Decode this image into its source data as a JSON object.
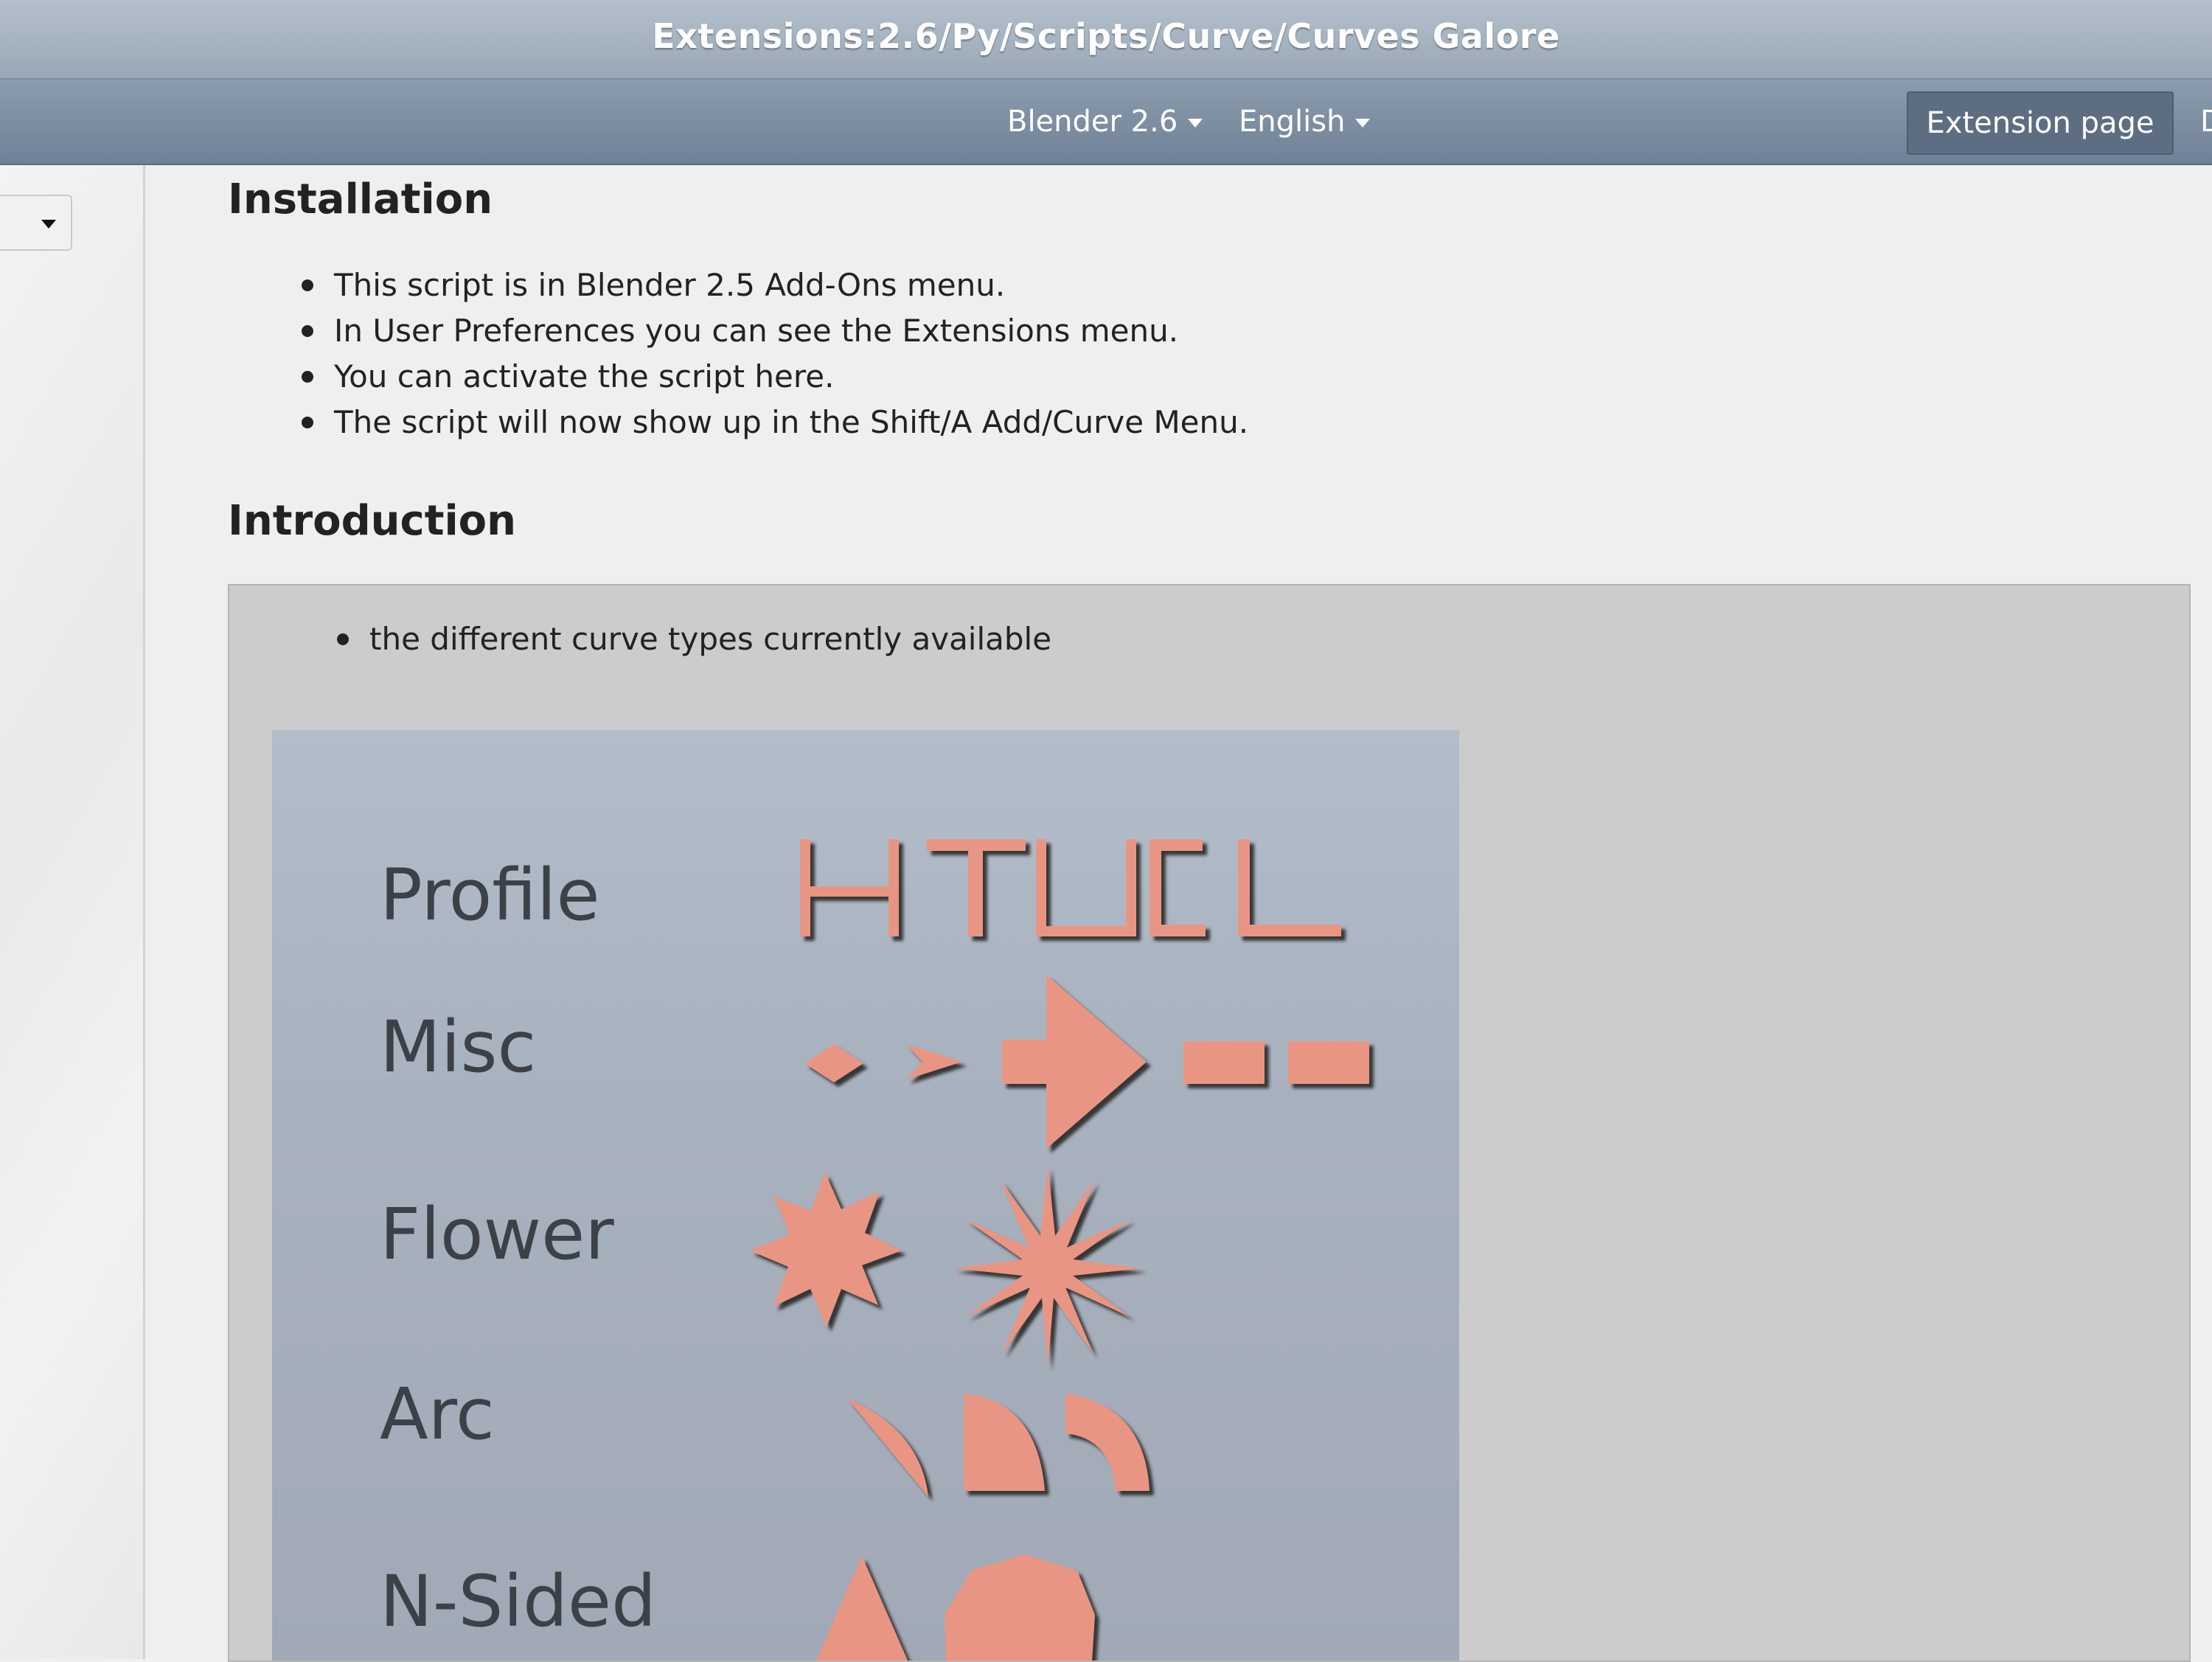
{
  "window": {
    "title": "Extensions:2.6/Py/Scripts/Curve/Curves Galore"
  },
  "nav": {
    "version_dropdown": "Blender 2.6",
    "language_dropdown": "English",
    "extension_page": "Extension page",
    "cut_item": "D"
  },
  "colors": {
    "shape_fill": "#e99584",
    "shadow": "#2a2a2a",
    "title_text": "#ffffff"
  },
  "installation": {
    "heading": "Installation",
    "items": [
      "This script is in Blender 2.5 Add-Ons menu.",
      "In User Preferences you can see the Extensions menu.",
      "You can activate the script here.",
      "The script will now show up in the Shift/A Add/Curve Menu."
    ]
  },
  "introduction": {
    "heading": "Introduction",
    "box_items": [
      "the different curve types currently available"
    ],
    "figure_labels": [
      "Profile",
      "Misc",
      "Flower",
      "Arc",
      "N-Sided"
    ]
  }
}
